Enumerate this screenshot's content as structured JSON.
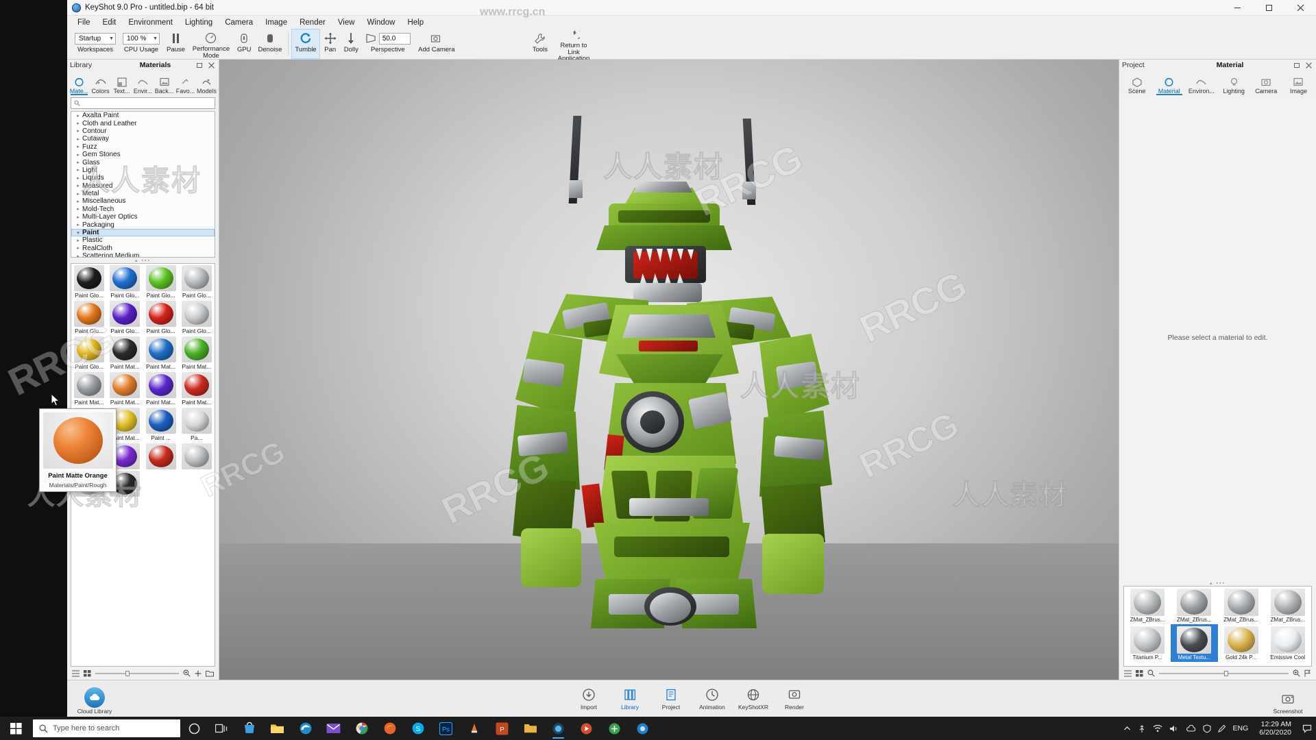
{
  "window": {
    "title": "KeyShot 9.0 Pro  -  untitled.bip  - 64 bit",
    "minimize": "─",
    "maximize": "❐",
    "close": "✕"
  },
  "menu": {
    "items": [
      "File",
      "Edit",
      "Environment",
      "Lighting",
      "Camera",
      "Image",
      "Render",
      "View",
      "Window",
      "Help"
    ]
  },
  "ribbon": {
    "workspaces": {
      "label": "Workspaces",
      "value": "Startup"
    },
    "cpu_usage": {
      "label": "CPU Usage",
      "value": "100 %"
    },
    "pause": {
      "label": "Pause"
    },
    "performance_mode": {
      "label": "Performance Mode"
    },
    "gpu": {
      "label": "GPU"
    },
    "denoise": {
      "label": "Denoise"
    },
    "tumble": {
      "label": "Tumble"
    },
    "pan": {
      "label": "Pan"
    },
    "dolly": {
      "label": "Dolly"
    },
    "perspective": {
      "label": "Perspective",
      "value": "50.0"
    },
    "add_camera": {
      "label": "Add Camera"
    },
    "tools": {
      "label": "Tools"
    },
    "return_to_link": {
      "label": "Return to Link Application"
    }
  },
  "library": {
    "panel_label": "Library",
    "panel_title": "Materials",
    "header_buttons": [
      "undock-icon",
      "close-icon"
    ],
    "tabs": [
      {
        "label": "Mate...",
        "icon": "material-sphere-icon",
        "selected": true
      },
      {
        "label": "Colors",
        "icon": "color-swatch-icon",
        "selected": false
      },
      {
        "label": "Text...",
        "icon": "texture-icon",
        "selected": false
      },
      {
        "label": "Envir...",
        "icon": "environment-icon",
        "selected": false
      },
      {
        "label": "Back...",
        "icon": "backplate-icon",
        "selected": false
      },
      {
        "label": "Favo...",
        "icon": "favorites-icon",
        "selected": false
      },
      {
        "label": "Models",
        "icon": "models-icon",
        "selected": false
      }
    ],
    "search": {
      "placeholder": "",
      "value": "",
      "icon": "search-icon"
    },
    "tree": [
      {
        "label": "Axalta Paint",
        "selected": false
      },
      {
        "label": "Cloth and Leather",
        "selected": false
      },
      {
        "label": "Contour",
        "selected": false
      },
      {
        "label": "Cutaway",
        "selected": false
      },
      {
        "label": "Fuzz",
        "selected": false
      },
      {
        "label": "Gem Stones",
        "selected": false
      },
      {
        "label": "Glass",
        "selected": false
      },
      {
        "label": "Light",
        "selected": false
      },
      {
        "label": "Liquids",
        "selected": false
      },
      {
        "label": "Measured",
        "selected": false
      },
      {
        "label": "Metal",
        "selected": false
      },
      {
        "label": "Miscellaneous",
        "selected": false
      },
      {
        "label": "Mold-Tech",
        "selected": false
      },
      {
        "label": "Multi-Layer Optics",
        "selected": false
      },
      {
        "label": "Packaging",
        "selected": false
      },
      {
        "label": "Paint",
        "selected": true
      },
      {
        "label": "Plastic",
        "selected": false
      },
      {
        "label": "RealCloth",
        "selected": false
      },
      {
        "label": "Scattering Medium",
        "selected": false
      }
    ],
    "swatches": [
      {
        "label": "Paint Glo...",
        "color": "#1d1d1f"
      },
      {
        "label": "Paint Glo...",
        "color": "#1f6fd0"
      },
      {
        "label": "Paint Glo...",
        "color": "#5cc122"
      },
      {
        "label": "Paint Glo...",
        "color": "#b9bcbe"
      },
      {
        "label": "Paint Glo...",
        "color": "#e1761a"
      },
      {
        "label": "Paint Glo...",
        "color": "#5b20c8"
      },
      {
        "label": "Paint Glo...",
        "color": "#d22218"
      },
      {
        "label": "Paint Glo...",
        "color": "#c9ccce"
      },
      {
        "label": "Paint Glo...",
        "color": "#e0b51c"
      },
      {
        "label": "Paint Mat...",
        "color": "#2b2b2d"
      },
      {
        "label": "Paint Mat...",
        "color": "#1e6fc6"
      },
      {
        "label": "Paint Mat...",
        "color": "#4ab028"
      },
      {
        "label": "Paint Mat...",
        "color": "#9a9da0"
      },
      {
        "label": "Paint Mat...",
        "color": "#e07f2c"
      },
      {
        "label": "Paint Mat...",
        "color": "#5b27cc"
      },
      {
        "label": "Paint Mat...",
        "color": "#cb2a20"
      },
      {
        "label": "Paint Mat...",
        "color": "#b0b4b6"
      },
      {
        "label": "Paint Mat...",
        "color": "#e2c02a"
      },
      {
        "label": "Paint ...",
        "color": "#1c5fc0"
      },
      {
        "label": "Pa...",
        "color": "#d8d9db"
      },
      {
        "label": "",
        "color": "#e8a721"
      },
      {
        "label": "",
        "color": "#7a2ad0"
      },
      {
        "label": "",
        "color": "#c52b1d"
      },
      {
        "label": "",
        "color": "#bdc0c2"
      },
      {
        "label": "",
        "color": "#cfd2d4"
      },
      {
        "label": "",
        "color": "#2a2a2c"
      }
    ],
    "footer": {
      "list_view_icon": "list-view-icon",
      "grid_view_icon": "grid-view-icon",
      "zoom_out_icon": "zoom-out-icon",
      "zoom_in_icon": "zoom-in-icon",
      "add_icon": "plus-icon",
      "folder_icon": "folder-icon"
    }
  },
  "tooltip": {
    "name": "Paint Matte Orange",
    "path": "Materials/Paint/Rough",
    "color": "#ed8336"
  },
  "material_panel": {
    "panel_label": "Project",
    "panel_title": "Material",
    "tabs": [
      {
        "label": "Scene",
        "icon": "scene-icon",
        "selected": false
      },
      {
        "label": "Material",
        "icon": "material-sphere-icon",
        "selected": true
      },
      {
        "label": "Environ...",
        "icon": "environment-icon",
        "selected": false
      },
      {
        "label": "Lighting",
        "icon": "lighting-icon",
        "selected": false
      },
      {
        "label": "Camera",
        "icon": "camera-icon",
        "selected": false
      },
      {
        "label": "Image",
        "icon": "image-icon",
        "selected": false
      }
    ],
    "empty_message": "Please select a material to edit.",
    "swatches": [
      {
        "label": "ZMat_ZBrus...",
        "color": "#b5b8ba",
        "selected": false
      },
      {
        "label": "ZMat_ZBrus...",
        "color": "#9ea1a4",
        "selected": false
      },
      {
        "label": "ZMat_ZBrus...",
        "color": "#a8abae",
        "selected": false
      },
      {
        "label": "ZMat_ZBrus...",
        "color": "#b0b3b6",
        "selected": false
      },
      {
        "label": "Titanium P...",
        "color": "#c2c5c8",
        "selected": false
      },
      {
        "label": "Metal Textu...",
        "color": "#4a4d50",
        "selected": true
      },
      {
        "label": "Gold 24k P...",
        "color": "#d8b14a",
        "selected": false
      },
      {
        "label": "Emissive Cool",
        "color": "#e9eef2",
        "selected": false
      }
    ]
  },
  "dock": {
    "items": [
      {
        "label": "Import",
        "icon": "import-icon",
        "selected": false
      },
      {
        "label": "Library",
        "icon": "library-icon",
        "selected": true
      },
      {
        "label": "Project",
        "icon": "project-icon",
        "selected": false
      },
      {
        "label": "Animation",
        "icon": "animation-icon",
        "selected": false
      },
      {
        "label": "KeyShotXR",
        "icon": "keyshotxr-icon",
        "selected": false
      },
      {
        "label": "Render",
        "icon": "render-icon",
        "selected": false
      }
    ],
    "cloud_library": {
      "label": "Cloud Library",
      "icon": "cloud-icon"
    },
    "screenshot": {
      "label": "Screenshot",
      "icon": "screenshot-icon"
    }
  },
  "taskbar": {
    "start_icon": "windows-start-icon",
    "search_placeholder": "Type here to search",
    "search_icon": "search-icon",
    "buttons": [
      "cortana-icon",
      "task-view-icon",
      "store-icon",
      "explorer-icon",
      "edge-icon",
      "mail-icon",
      "chrome-icon",
      "firefox-icon",
      "skype-icon",
      "photoshop-icon",
      "vlc-icon",
      "powerpoint-icon",
      "folder-icon",
      "keyshot-icon",
      "media-icon",
      "apps-icon",
      "blue-app-icon"
    ],
    "tray": {
      "show_hidden_icon": "chevron-up-icon",
      "usb_icon": "usb-icon",
      "network_icon": "network-icon",
      "volume_icon": "volume-icon",
      "cloud_icon": "cloud-icon",
      "shield_icon": "shield-icon",
      "pen_icon": "pen-icon",
      "language": "ENG",
      "time": "12:29 AM",
      "date": "6/20/2020",
      "notification_icon": "notification-icon"
    }
  },
  "watermarks": {
    "top": "www.rrcg.cn",
    "brand": "RRCG",
    "chinese": "人人素材"
  }
}
